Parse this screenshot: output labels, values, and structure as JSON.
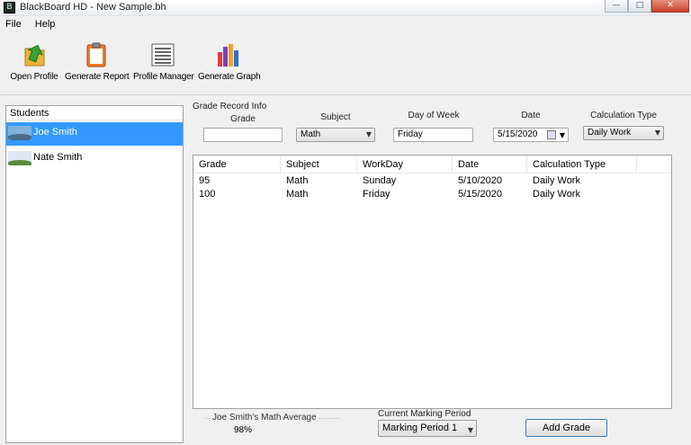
{
  "window": {
    "title": "BlackBoard HD - New Sample.bh",
    "minimize_glyph": "—",
    "maximize_glyph": "□",
    "close_glyph": "✕"
  },
  "menu": [
    "File",
    "Help"
  ],
  "toolbar": [
    {
      "label": "Open Profile",
      "icon": "open-profile-icon"
    },
    {
      "label": "Generate Report",
      "icon": "clipboard-icon"
    },
    {
      "label": "Profile Manager",
      "icon": "list-icon"
    },
    {
      "label": "Generate Graph",
      "icon": "bar-chart-icon"
    }
  ],
  "students": {
    "header": "Students",
    "items": [
      {
        "name": "Joe Smith",
        "selected": true
      },
      {
        "name": "Nate Smith",
        "selected": false
      }
    ]
  },
  "form": {
    "group_label": "Grade Record Info",
    "grade_label": "Grade",
    "grade_value": "",
    "subject_label": "Subject",
    "subject_value": "Math",
    "day_label": "Day of Week",
    "day_value": "Friday",
    "date_label": "Date",
    "date_value": "5/15/2020",
    "calc_label": "Calculation Type",
    "calc_value": "Daily Work"
  },
  "grid": {
    "columns": [
      "Grade",
      "Subject",
      "WorkDay",
      "Date",
      "Calculation Type"
    ],
    "rows": [
      [
        "95",
        "Math",
        "Sunday",
        "5/10/2020",
        "Daily Work"
      ],
      [
        "100",
        "Math",
        "Friday",
        "5/15/2020",
        "Daily Work"
      ]
    ]
  },
  "footer": {
    "average_label": "Joe Smith's Math Average",
    "average_value": "98%",
    "marking_period_label": "Current Marking Period",
    "marking_period_value": "Marking Period 1",
    "add_button": "Add Grade"
  },
  "colors": {
    "selection": "#3399ff",
    "accent_border": "#3c7fb1"
  }
}
